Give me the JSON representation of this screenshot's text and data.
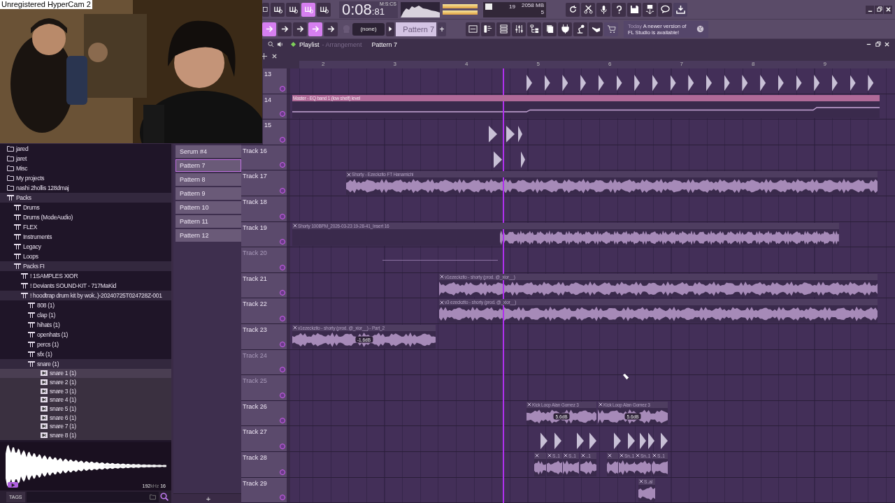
{
  "overlay": {
    "caption": "Unregistered HyperCam 2"
  },
  "toolbar": {
    "mode_buttons": [
      {
        "selected": false
      },
      {
        "selected": false
      },
      {
        "selected": true
      },
      {
        "selected": false
      }
    ],
    "time": {
      "main": "0:08",
      "cs": ":81",
      "unit": "M:S:CS"
    },
    "cpu": {
      "voices": "19",
      "memory": "2058 MB",
      "polyphony": "5"
    },
    "snap_buttons": [
      {
        "selected": true
      },
      {
        "selected": false
      },
      {
        "selected": false
      },
      {
        "selected": true
      },
      {
        "selected": false
      }
    ],
    "preset": "(none)",
    "pattern": "Pattern 7",
    "add": "+",
    "news": {
      "when": "Today",
      "text": "A newer version of FL Studio is available!"
    }
  },
  "playlist": {
    "title": "Playlist",
    "subtitle": "- Arrangement",
    "pattern": "Pattern 7",
    "ruler": [
      "2",
      "3",
      "4",
      "5",
      "6",
      "7",
      "8",
      "9"
    ],
    "tracks": [
      {
        "label": "13",
        "covered": true,
        "muted": false
      },
      {
        "label": "14",
        "covered": true,
        "muted": false,
        "clips": [
          {
            "kind": "automation",
            "title": "Master - EQ band 1 (low shelf) level"
          }
        ]
      },
      {
        "label": "15",
        "covered": true,
        "muted": false
      },
      {
        "label": "Track 16",
        "muted": false
      },
      {
        "label": "Track 17",
        "muted": false,
        "clips": [
          {
            "kind": "audio",
            "title": "Shorty - Ezeckzito FT Hanamichi"
          }
        ]
      },
      {
        "label": "Track 18",
        "muted": false
      },
      {
        "label": "Track 19",
        "muted": false,
        "clips": [
          {
            "kind": "audio",
            "title": "Shorty 100BPM_2026-03-23 19-28-41_Insert 16"
          }
        ]
      },
      {
        "label": "Track 20",
        "muted": true,
        "clips": [
          {
            "kind": "line"
          }
        ]
      },
      {
        "label": "Track 21",
        "muted": false,
        "clips": [
          {
            "kind": "audio",
            "title": "v1ezeckzito - shorty (prod. @_xior__)"
          }
        ]
      },
      {
        "label": "Track 22",
        "muted": false,
        "clips": [
          {
            "kind": "audio",
            "title": "v3 ezeckzito - shorty (prod. @_xior__)"
          }
        ]
      },
      {
        "label": "Track 23",
        "muted": false,
        "clips": [
          {
            "kind": "audio",
            "title": "v1ezeckzito - shorty (prod. @_xior__) - Part_2",
            "badge": "-1.6dB"
          }
        ]
      },
      {
        "label": "Track 24",
        "muted": true
      },
      {
        "label": "Track 25",
        "muted": true
      },
      {
        "label": "Track 26",
        "muted": false,
        "clips": [
          {
            "kind": "audio",
            "title": "Kick Loop Alan Gomez 3",
            "badge": "5.6dB"
          },
          {
            "kind": "audio",
            "title": "Kick Loop Alan Gomez 3",
            "badge": "5.6dB"
          }
        ]
      },
      {
        "label": "Track 27",
        "muted": false
      },
      {
        "label": "Track 28",
        "muted": false,
        "clips": [
          {
            "kind": "audio"
          },
          {
            "kind": "audio",
            "title": "S..1"
          },
          {
            "kind": "audio",
            "title": "S..1"
          },
          {
            "kind": "audio",
            "title": "..1"
          },
          {
            "kind": "audio"
          },
          {
            "kind": "audio",
            "title": "Sn..1"
          },
          {
            "kind": "audio",
            "title": "Sn..1"
          },
          {
            "kind": "audio",
            "title": "S..1"
          }
        ]
      },
      {
        "label": "Track 29",
        "muted": false,
        "clips": [
          {
            "kind": "audio",
            "title": "S..al"
          }
        ]
      }
    ]
  },
  "browser": {
    "items": [
      {
        "kind": "folder",
        "label": "jared"
      },
      {
        "kind": "folder",
        "label": "jaret"
      },
      {
        "kind": "folder",
        "label": "Misc"
      },
      {
        "kind": "folder",
        "label": "My projects"
      },
      {
        "kind": "folder",
        "label": "nashi 2hollis 128dmaj"
      },
      {
        "kind": "pack",
        "label": "Packs",
        "expanded": true,
        "children": [
          {
            "kind": "pack",
            "label": "Drums",
            "expanded": false
          },
          {
            "kind": "pack",
            "label": "Drums (ModeAudio)",
            "expanded": false
          },
          {
            "kind": "pack",
            "label": "FLEX",
            "expanded": false
          },
          {
            "kind": "pack",
            "label": "Instruments",
            "expanded": false
          },
          {
            "kind": "pack",
            "label": "Legacy",
            "expanded": false
          },
          {
            "kind": "pack",
            "label": "Loops",
            "expanded": false
          },
          {
            "kind": "pack",
            "label": "Packs FI",
            "expanded": true,
            "children": [
              {
                "kind": "pack",
                "label": "! 1SAMPLES XIOR",
                "expanded": false
              },
              {
                "kind": "pack",
                "label": "! Deviants SOUND-KIT - 717MaKid",
                "expanded": false
              },
              {
                "kind": "pack",
                "label": "! hoodtrap drum kit by wok..)-20240725T024728Z-001",
                "expanded": true,
                "children": [
                  {
                    "kind": "pack",
                    "label": "808 (1)",
                    "expanded": false
                  },
                  {
                    "kind": "pack",
                    "label": "clap (1)",
                    "expanded": false
                  },
                  {
                    "kind": "pack",
                    "label": "hihats (1)",
                    "expanded": false
                  },
                  {
                    "kind": "pack",
                    "label": "openhats (1)",
                    "expanded": false
                  },
                  {
                    "kind": "pack",
                    "label": "percs (1)",
                    "expanded": false
                  },
                  {
                    "kind": "pack",
                    "label": "sfx (1)",
                    "expanded": false
                  },
                  {
                    "kind": "pack",
                    "label": "snare (1)",
                    "expanded": true,
                    "children": [
                      {
                        "kind": "sample",
                        "label": "snare 1 (1)",
                        "selected": true
                      },
                      {
                        "kind": "sample",
                        "label": "snare 2 (1)",
                        "selected": false
                      },
                      {
                        "kind": "sample",
                        "label": "snare 3 (1)",
                        "selected": false
                      },
                      {
                        "kind": "sample",
                        "label": "snare 4 (1)",
                        "selected": false
                      },
                      {
                        "kind": "sample",
                        "label": "snare 5 (1)",
                        "selected": false
                      },
                      {
                        "kind": "sample",
                        "label": "snare 6 (1)",
                        "selected": false
                      },
                      {
                        "kind": "sample",
                        "label": "snare 7 (1)",
                        "selected": false
                      },
                      {
                        "kind": "sample",
                        "label": "snare 8 (1)",
                        "selected": false
                      }
                    ]
                  }
                ]
              }
            ]
          }
        ]
      }
    ],
    "preview": {
      "rate": "192",
      "rate_unit": "kHz",
      "bits": "16"
    },
    "tags": "TAGS"
  },
  "patterns": {
    "items": [
      {
        "label": "Serum #4",
        "selected": false
      },
      {
        "label": "Pattern 7",
        "selected": true
      },
      {
        "label": "Pattern 8",
        "selected": false
      },
      {
        "label": "Pattern 9",
        "selected": false
      },
      {
        "label": "Pattern 10",
        "selected": false
      },
      {
        "label": "Pattern 11",
        "selected": false
      },
      {
        "label": "Pattern 12",
        "selected": false
      }
    ],
    "add": "+"
  }
}
